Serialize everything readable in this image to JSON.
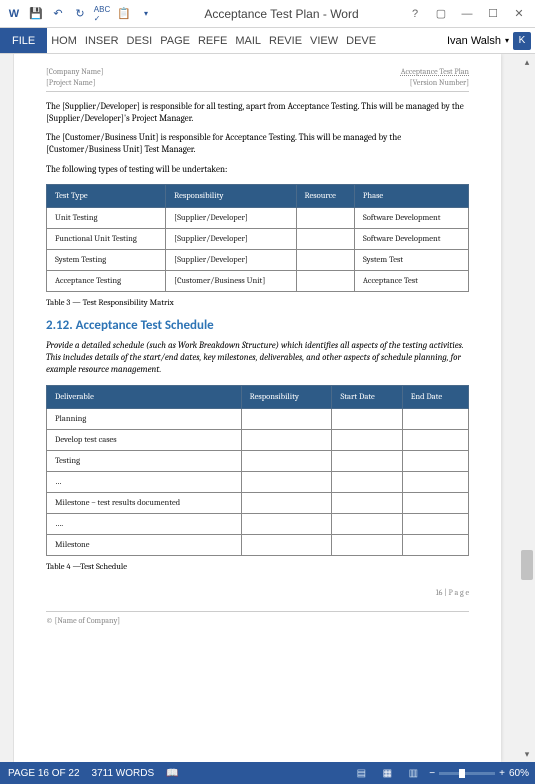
{
  "titlebar": {
    "title": "Acceptance Test Plan - Word"
  },
  "ribbon": {
    "file": "FILE",
    "tabs": [
      "HOM",
      "INSER",
      "DESI",
      "PAGE",
      "REFE",
      "MAIL",
      "REVIE",
      "VIEW",
      "DEVE"
    ],
    "user": "Ivan Walsh",
    "user_initial": "K"
  },
  "doc": {
    "company": "[Company Name]",
    "project": "[Project Name]",
    "doctitle": "Acceptance Test Plan",
    "version": "[Version Number]",
    "para1": "The [Supplier/Developer] is responsible for all testing, apart from Acceptance Testing. This will be managed by the [Supplier/Developer]'s Project Manager.",
    "para2": "The [Customer/Business Unit] is responsible for Acceptance Testing. This will be managed by the [Customer/Business Unit] Test Manager.",
    "para3": "The following types of testing will be undertaken:",
    "table1": {
      "headers": [
        "Test Type",
        "Responsibility",
        "Resource",
        "Phase"
      ],
      "rows": [
        [
          "Unit Testing",
          "[Supplier/Developer]",
          "",
          "Software Development"
        ],
        [
          "Functional Unit Testing",
          "[Supplier/Developer]",
          "",
          "Software Development"
        ],
        [
          "System Testing",
          "[Supplier/Developer]",
          "",
          "System Test"
        ],
        [
          "Acceptance Testing",
          "[Customer/Business Unit]",
          "",
          "Acceptance Test"
        ]
      ]
    },
    "caption1": "Table 3 — Test Responsibility Matrix",
    "heading": "2.12.  Acceptance Test Schedule",
    "para4": "Provide a detailed schedule (such as Work Breakdown Structure) which identifies all aspects of the testing activities. This includes details of the start/end dates, key milestones, deliverables, and other aspects of schedule planning, for example resource management.",
    "table2": {
      "headers": [
        "Deliverable",
        "Responsibility",
        "Start Date",
        "End Date"
      ],
      "rows": [
        [
          "Planning",
          "",
          "",
          ""
        ],
        [
          "Develop test cases",
          "",
          "",
          ""
        ],
        [
          "Testing",
          "",
          "",
          ""
        ],
        [
          "…",
          "",
          "",
          ""
        ],
        [
          "Milestone – test results documented",
          "",
          "",
          ""
        ],
        [
          "….",
          "",
          "",
          ""
        ],
        [
          "Milestone",
          "",
          "",
          ""
        ]
      ]
    },
    "caption2": "Table 4 —Test Schedule",
    "pagenum": "16 | P a g e",
    "copyright": "© [Name of Company]"
  },
  "status": {
    "page": "PAGE 16 OF 22",
    "words": "3711 WORDS",
    "zoom": "60%"
  }
}
